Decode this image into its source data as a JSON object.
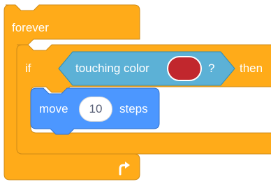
{
  "blocks": {
    "forever": {
      "label": "forever",
      "loop_arrow_icon": "loop-arrow-icon"
    },
    "if_block": {
      "if_label": "if",
      "then_label": "then",
      "condition": {
        "label": "touching color",
        "question_mark": "?",
        "swatch_color": "#c1272d"
      }
    },
    "move": {
      "label_before": "move",
      "steps_value": "10",
      "label_after": "steps"
    }
  },
  "colors": {
    "control": "#ffab19",
    "control_border": "#cf8b17",
    "sensing": "#5cb1d6",
    "sensing_border": "#2e8eb8",
    "motion": "#4c97ff",
    "motion_border": "#3373cc",
    "text": "#ffffff"
  }
}
